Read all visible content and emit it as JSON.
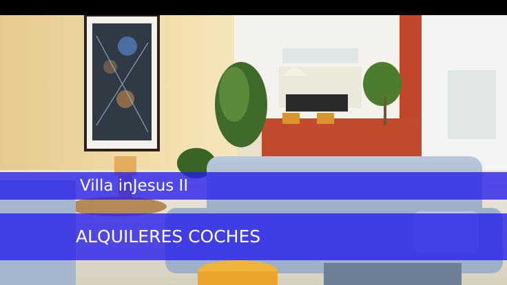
{
  "banner": {
    "title": "Villa inJesus II",
    "subtitle": "ALQUILERES COCHES"
  },
  "colors": {
    "band": "#241ceb",
    "text": "#ffffff"
  }
}
